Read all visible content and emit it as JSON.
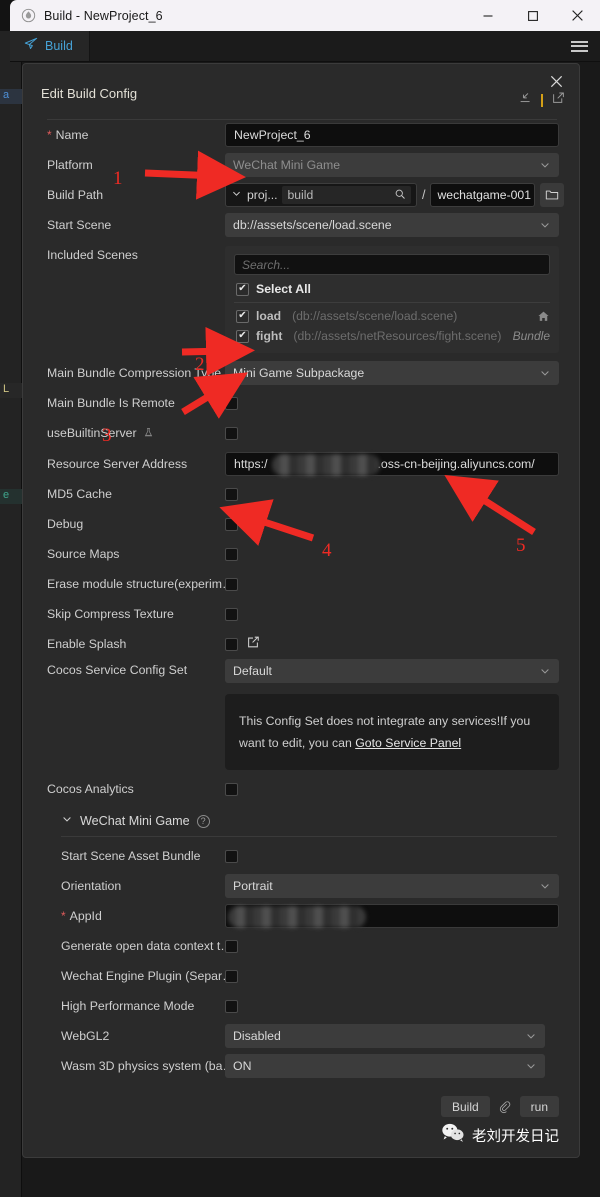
{
  "window": {
    "title": "Build - NewProject_6",
    "app_icon": "cocos-droplet-icon",
    "minimize": "—",
    "maximize": "□",
    "close": "✕"
  },
  "tabbar": {
    "tab_label": "Build",
    "tab_icon": "paper-plane-icon",
    "menu_icon": "hamburger-menu-icon"
  },
  "background_panels": [
    {
      "text": "a"
    },
    {
      "text": "L"
    },
    {
      "text": "e"
    }
  ],
  "dialog": {
    "title": "Edit Build Config",
    "close_icon": "close-icon",
    "collapse_icon": "collapse-arrow-icon",
    "popout_icon": "open-external-icon",
    "divider_color": "#d4a017"
  },
  "form": {
    "name": {
      "label": "Name",
      "required": true,
      "value": "NewProject_6"
    },
    "platform": {
      "label": "Platform",
      "value": "WeChat Mini Game",
      "options": [
        "WeChat Mini Game"
      ]
    },
    "build_path": {
      "label": "Build Path",
      "project_token": "proj...",
      "folder_value": "build",
      "separator": "/",
      "dir_value": "wechatgame-001",
      "search_icon": "magnifier-icon",
      "folder_icon": "folder-icon"
    },
    "start_scene": {
      "label": "Start Scene",
      "value": "db://assets/scene/load.scene"
    },
    "included_scenes": {
      "label": "Included Scenes",
      "search_placeholder": "Search...",
      "select_all_label": "Select All",
      "select_all_checked": true,
      "items": [
        {
          "name": "load",
          "path": "(db://assets/scene/load.scene)",
          "checked": true,
          "badge": "",
          "icon": "home-icon"
        },
        {
          "name": "fight",
          "path": "(db://assets/netResources/fight.scene)",
          "checked": true,
          "badge": "Bundle",
          "icon": ""
        }
      ]
    },
    "main_bundle_compression_type": {
      "label": "Main Bundle Compression Type",
      "value": "Mini Game Subpackage"
    },
    "main_bundle_is_remote": {
      "label": "Main Bundle Is Remote",
      "checked": false
    },
    "use_builtin_server": {
      "label": "useBuiltinServer",
      "checked": false,
      "icon": "experimental-flask-icon"
    },
    "resource_server_address": {
      "label": "Resource Server Address",
      "value_prefix": "https:/",
      "value_suffix": ".oss-cn-beijing.aliyuncs.com/",
      "masked": true
    },
    "md5_cache": {
      "label": "MD5 Cache",
      "checked": false
    },
    "debug": {
      "label": "Debug",
      "checked": false
    },
    "source_maps": {
      "label": "Source Maps",
      "checked": false
    },
    "erase_module_structure": {
      "label": "Erase module structure(experim…",
      "checked": false
    },
    "skip_compress_texture": {
      "label": "Skip Compress Texture",
      "checked": false
    },
    "enable_splash": {
      "label": "Enable Splash",
      "checked": false,
      "edit_icon": "edit-square-icon"
    },
    "cocos_service_config_set": {
      "label": "Cocos Service Config Set",
      "value": "Default",
      "hint_text": "This Config Set does not integrate any services!If you want to edit, you can ",
      "hint_link": "Goto Service Panel"
    },
    "cocos_analytics": {
      "label": "Cocos Analytics",
      "checked": false
    }
  },
  "wechat_section": {
    "title": "WeChat Mini Game",
    "help_icon": "question-mark-icon",
    "expanded": true,
    "rows": {
      "start_scene_asset_bundle": {
        "label": "Start Scene Asset Bundle",
        "checked": false
      },
      "orientation": {
        "label": "Orientation",
        "value": "Portrait"
      },
      "appid": {
        "label": "AppId",
        "required": true,
        "value": "",
        "masked": true
      },
      "generate_open_data_context": {
        "label": "Generate open data context t…",
        "checked": false
      },
      "wechat_engine_plugin": {
        "label": "Wechat Engine Plugin (Separ…",
        "checked": false
      },
      "high_performance_mode": {
        "label": "High Performance Mode",
        "checked": false
      },
      "webgl2": {
        "label": "WebGL2",
        "value": "Disabled"
      },
      "wasm_3d_physics": {
        "label": "Wasm 3D physics system (ba…",
        "value": "ON"
      }
    }
  },
  "footer": {
    "build_label": "Build",
    "link_icon": "paperclip-icon",
    "run_label": "run",
    "watermark_icon": "wechat-icon",
    "watermark_text": "老刘开发日记"
  },
  "annotations": {
    "color": "#ef2a24",
    "markers": [
      {
        "number": "1",
        "target": "platform-field"
      },
      {
        "number": "2",
        "target": "included-scenes-fight-row"
      },
      {
        "number": "3",
        "target": "main-bundle-compression-type"
      },
      {
        "number": "4",
        "target": "md5-cache-checkbox"
      },
      {
        "number": "5",
        "target": "resource-server-address"
      }
    ]
  }
}
